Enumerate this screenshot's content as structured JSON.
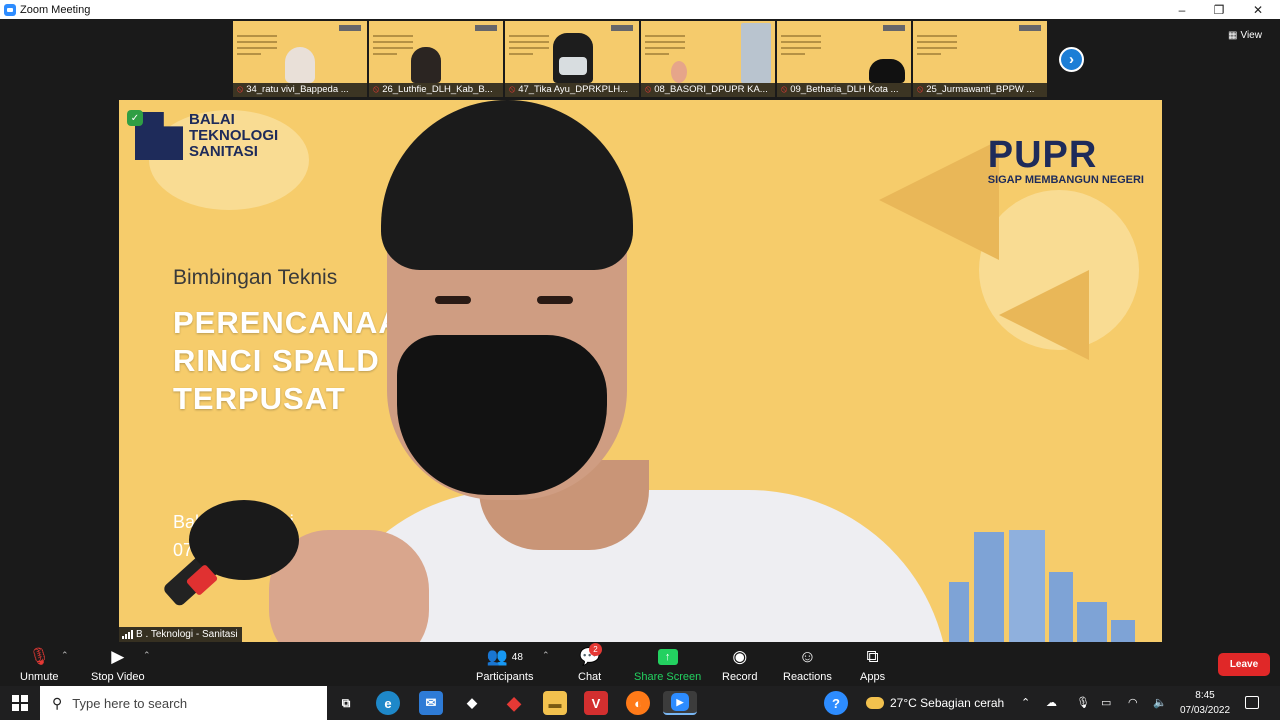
{
  "window": {
    "title": "Zoom Meeting",
    "controls": {
      "minimize": "–",
      "restore": "❐",
      "close": "✕"
    }
  },
  "gallery": {
    "thumbnails": [
      {
        "name": "34_ratu vivi_Bappeda ...",
        "muted": true
      },
      {
        "name": "26_Luthfie_DLH_Kab_B...",
        "muted": true
      },
      {
        "name": "47_Tika Ayu_DPRKPLH...",
        "muted": true
      },
      {
        "name": "08_BASORI_DPUPR KA...",
        "muted": true
      },
      {
        "name": "09_Betharia_DLH Kota ...",
        "muted": true
      },
      {
        "name": "25_Jurmawanti_BPPW ...",
        "muted": true
      }
    ],
    "next_icon": "›",
    "view_label": "View"
  },
  "main_video": {
    "slide": {
      "org_logo_text": "BALAI\nTEKNOLOGI\nSANITASI",
      "brand": "PUPR",
      "tagline": "SIGAP MEMBANGUN NEGERI",
      "subtitle": "Bimbingan Teknis",
      "title_line1": "PERENCANAAN",
      "title_line2": "RINCI SPALD",
      "title_line3": "TERPUSAT",
      "footer_line1": "Balai Teknologi",
      "footer_line2": "07"
    },
    "speaker_name": "B . Teknologi - Sanitasi"
  },
  "toolbar": {
    "unmute_label": "Unmute",
    "stop_video_label": "Stop Video",
    "participants_label": "Participants",
    "participants_count": "48",
    "chat_label": "Chat",
    "chat_badge": "2",
    "share_label": "Share Screen",
    "record_label": "Record",
    "reactions_label": "Reactions",
    "apps_label": "Apps",
    "leave_label": "Leave"
  },
  "taskbar": {
    "search_placeholder": "Type here to search",
    "weather_text": "27°C  Sebagian cerah",
    "time": "8:45",
    "date": "07/03/2022"
  },
  "colors": {
    "slide_bg": "#f6cc6b",
    "brand_navy": "#1e2b5a",
    "share_green": "#23d160",
    "leave_red": "#e02828",
    "zoom_blue": "#2d8cff"
  }
}
